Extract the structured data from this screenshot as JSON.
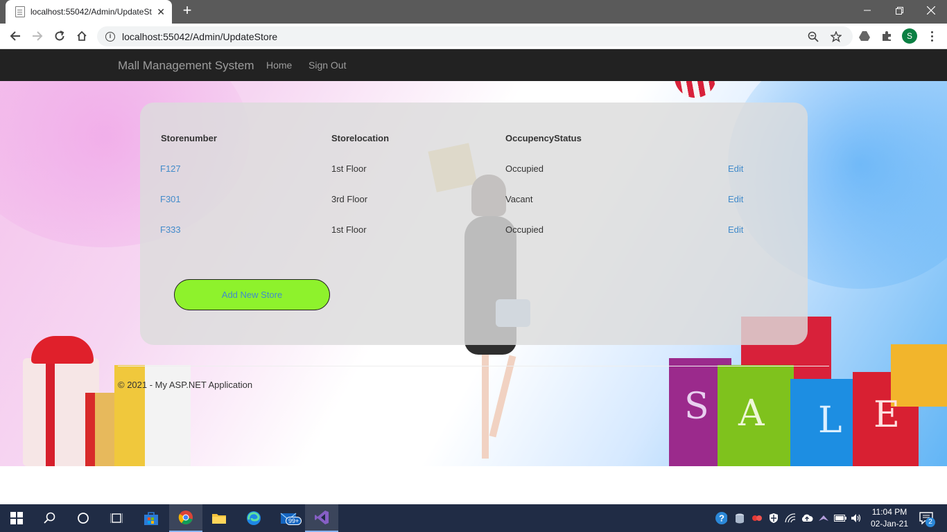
{
  "browser": {
    "tab_title": "localhost:55042/Admin/UpdateSt",
    "url": "localhost:55042/Admin/UpdateStore",
    "profile_initial": "S"
  },
  "navbar": {
    "brand": "Mall Management System",
    "links": [
      "Home",
      "Sign Out"
    ]
  },
  "table": {
    "headers": [
      "Storenumber",
      "Storelocation",
      "OccupencyStatus"
    ],
    "rows": [
      {
        "number": "F127",
        "location": "1st Floor",
        "status": "Occupied",
        "action": "Edit"
      },
      {
        "number": "F301",
        "location": "3rd Floor",
        "status": "Vacant",
        "action": "Edit"
      },
      {
        "number": "F333",
        "location": "1st Floor",
        "status": "Occupied",
        "action": "Edit"
      }
    ]
  },
  "add_button": "Add New Store",
  "footer": "© 2021 - My ASP.NET Application",
  "taskbar": {
    "time": "11:04 PM",
    "date": "02-Jan-21",
    "mail_badge": "99+",
    "notification_count": "2"
  },
  "colors": {
    "navbar_bg": "#222222",
    "link": "#428bca",
    "add_button_bg": "#8ef22c",
    "taskbar_bg": "#202c45"
  }
}
